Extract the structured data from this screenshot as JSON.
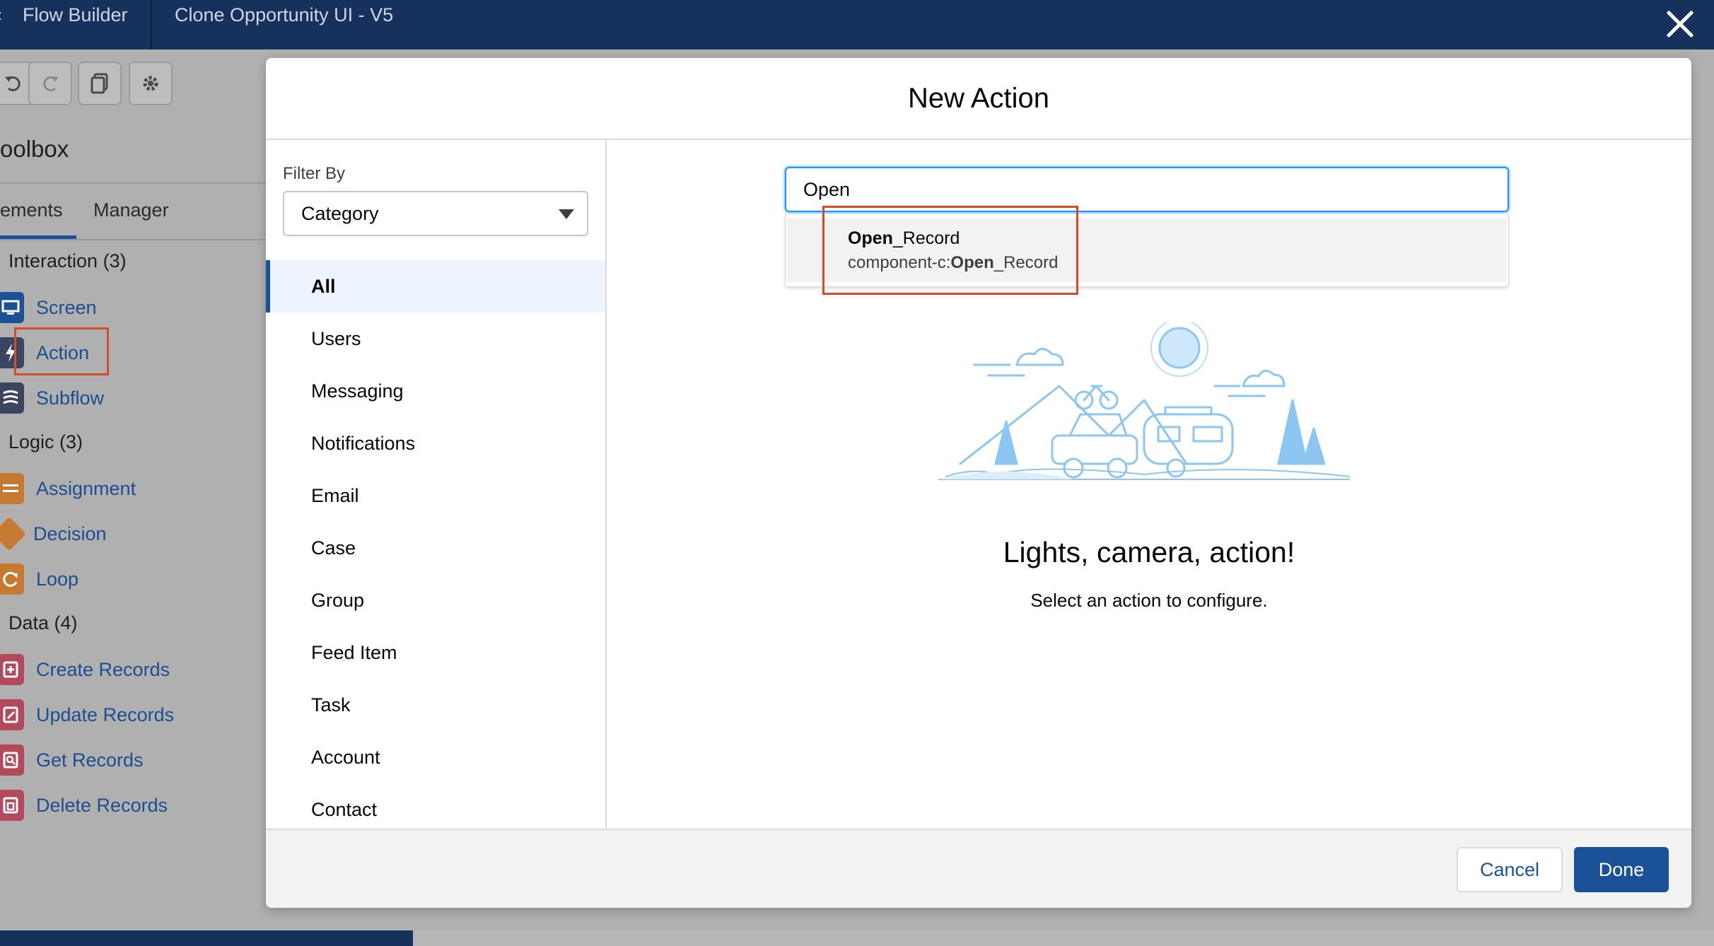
{
  "topbar": {
    "app_name": "Flow Builder",
    "flow_name": "Clone Opportunity UI - V5"
  },
  "sidebar": {
    "title": "oolbox",
    "tabs": [
      {
        "label": "ements"
      },
      {
        "label": "Manager"
      }
    ],
    "groups": [
      {
        "label": "Interaction (3)"
      },
      {
        "label": "Logic (3)"
      },
      {
        "label": "Data (4)"
      }
    ],
    "items": [
      {
        "label": "Screen",
        "icon": "screen-icon",
        "color": "#1b5297"
      },
      {
        "label": "Action",
        "icon": "lightning-icon",
        "color": "#3a4660"
      },
      {
        "label": "Subflow",
        "icon": "subflow-icon",
        "color": "#3a4660"
      },
      {
        "label": "Assignment",
        "icon": "assignment-icon",
        "color": "#c57931"
      },
      {
        "label": "Decision",
        "icon": "decision-icon",
        "color": "#c57931"
      },
      {
        "label": "Loop",
        "icon": "loop-icon",
        "color": "#c57931"
      },
      {
        "label": "Create Records",
        "icon": "record-create-icon",
        "color": "#b34a5b"
      },
      {
        "label": "Update Records",
        "icon": "record-update-icon",
        "color": "#b34a5b"
      },
      {
        "label": "Get Records",
        "icon": "record-lookup-icon",
        "color": "#b34a5b"
      },
      {
        "label": "Delete Records",
        "icon": "record-delete-icon",
        "color": "#b34a5b"
      }
    ]
  },
  "modal": {
    "title": "New Action",
    "filter_label": "Filter By",
    "filter_value": "Category",
    "categories": [
      {
        "label": "All"
      },
      {
        "label": "Users"
      },
      {
        "label": "Messaging"
      },
      {
        "label": "Notifications"
      },
      {
        "label": "Email"
      },
      {
        "label": "Case"
      },
      {
        "label": "Group"
      },
      {
        "label": "Feed Item"
      },
      {
        "label": "Task"
      },
      {
        "label": "Account"
      },
      {
        "label": "Contact"
      }
    ],
    "search_value": "Open",
    "result": {
      "title_bold": "Open",
      "title_rest": "_Record",
      "sub_prefix": "component-c:",
      "sub_bold": "Open",
      "sub_rest": "_Record"
    },
    "empty_title": "Lights, camera, action!",
    "empty_sub": "Select an action to configure.",
    "cancel_label": "Cancel",
    "done_label": "Done"
  },
  "colors": {
    "brand": "#1b5297",
    "highlight": "#d84a2c",
    "focus": "#1b96ff",
    "illustration": "#8cc6f1"
  }
}
